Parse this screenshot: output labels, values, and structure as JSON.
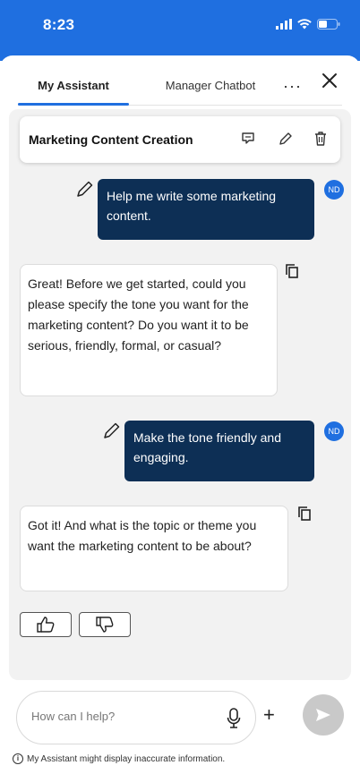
{
  "status_bar": {
    "time": "8:23"
  },
  "tabs": [
    {
      "label": "My Assistant"
    },
    {
      "label": "Manager Chatbot"
    }
  ],
  "header": {
    "more": "···"
  },
  "conversation": {
    "title": "Marketing Content Creation"
  },
  "messages": [
    {
      "role": "user",
      "text": "Help me write some marketing content.",
      "avatar": "ND"
    },
    {
      "role": "assistant",
      "text": "Great! Before we get started, could you please specify the tone you want for the marketing content? Do you want it to be serious, friendly, formal, or casual?"
    },
    {
      "role": "user",
      "text": "Make the tone friendly and engaging.",
      "avatar": "ND"
    },
    {
      "role": "assistant",
      "text": "Got it! And what is the topic or theme you want the marketing content to be about?"
    }
  ],
  "composer": {
    "placeholder": "How can I help?",
    "plus": "+"
  },
  "disclaimer": "My Assistant might display inaccurate information.",
  "colors": {
    "accent": "#1f6fe0",
    "user_bubble": "#0d2f55",
    "chat_bg": "#f2f2f2",
    "send_disabled": "#c9c9c9"
  }
}
